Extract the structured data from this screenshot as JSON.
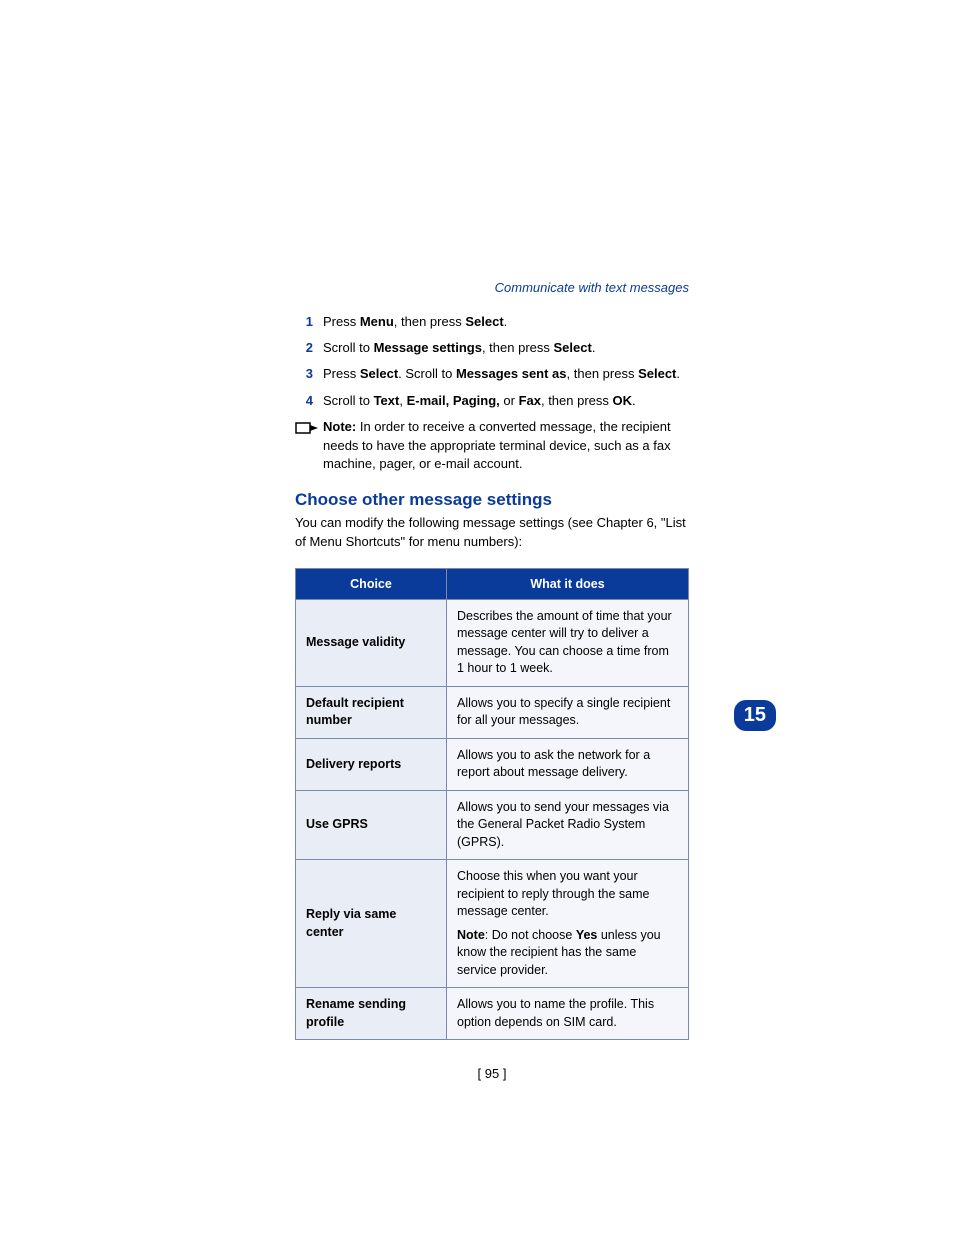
{
  "header": "Communicate with text messages",
  "steps": [
    {
      "num": "1",
      "html": "Press <b>Menu</b>, then press <b>Select</b>."
    },
    {
      "num": "2",
      "html": "Scroll to <b>Message settings</b>, then press <b>Select</b>."
    },
    {
      "num": "3",
      "html": "Press <b>Select</b>. Scroll to <b>Messages sent as</b>, then press <b>Select</b>."
    },
    {
      "num": "4",
      "html": "Scroll to <b>Text</b>, <b>E-mail, Paging,</b> or <b>Fax</b>, then press <b>OK</b>."
    }
  ],
  "note": {
    "label": "Note:",
    "text": "In order to receive a converted message, the recipient needs to have the appropriate terminal device, such as a fax machine, pager, or e-mail account."
  },
  "section_heading": "Choose other message settings",
  "intro": "You can modify the following message settings (see Chapter 6, \"List of Menu Shortcuts\" for menu numbers):",
  "table": {
    "col1": "Choice",
    "col2": "What it does",
    "rows": [
      {
        "choice": "Message validity",
        "desc": "Describes the amount of time that your message center will try to deliver a message. You can choose a time from 1 hour to 1 week."
      },
      {
        "choice": "Default recipient number",
        "desc": "Allows you to specify a single recipient for all your messages."
      },
      {
        "choice": "Delivery reports",
        "desc": "Allows you to ask the network for a report about message delivery."
      },
      {
        "choice": "Use GPRS",
        "desc": "Allows you to send your messages via the General Packet Radio System (GPRS)."
      },
      {
        "choice": "Reply via same center",
        "desc": "Choose this when you want your recipient to reply through the same message center.",
        "note_label": "Note",
        "note_text": ": Do not choose <b>Yes</b> unless you know the recipient has the same service provider."
      },
      {
        "choice": "Rename sending profile",
        "desc": "Allows you to name the profile. This option depends on SIM card."
      }
    ]
  },
  "page_number": "[ 95 ]",
  "chapter_tab": "15"
}
